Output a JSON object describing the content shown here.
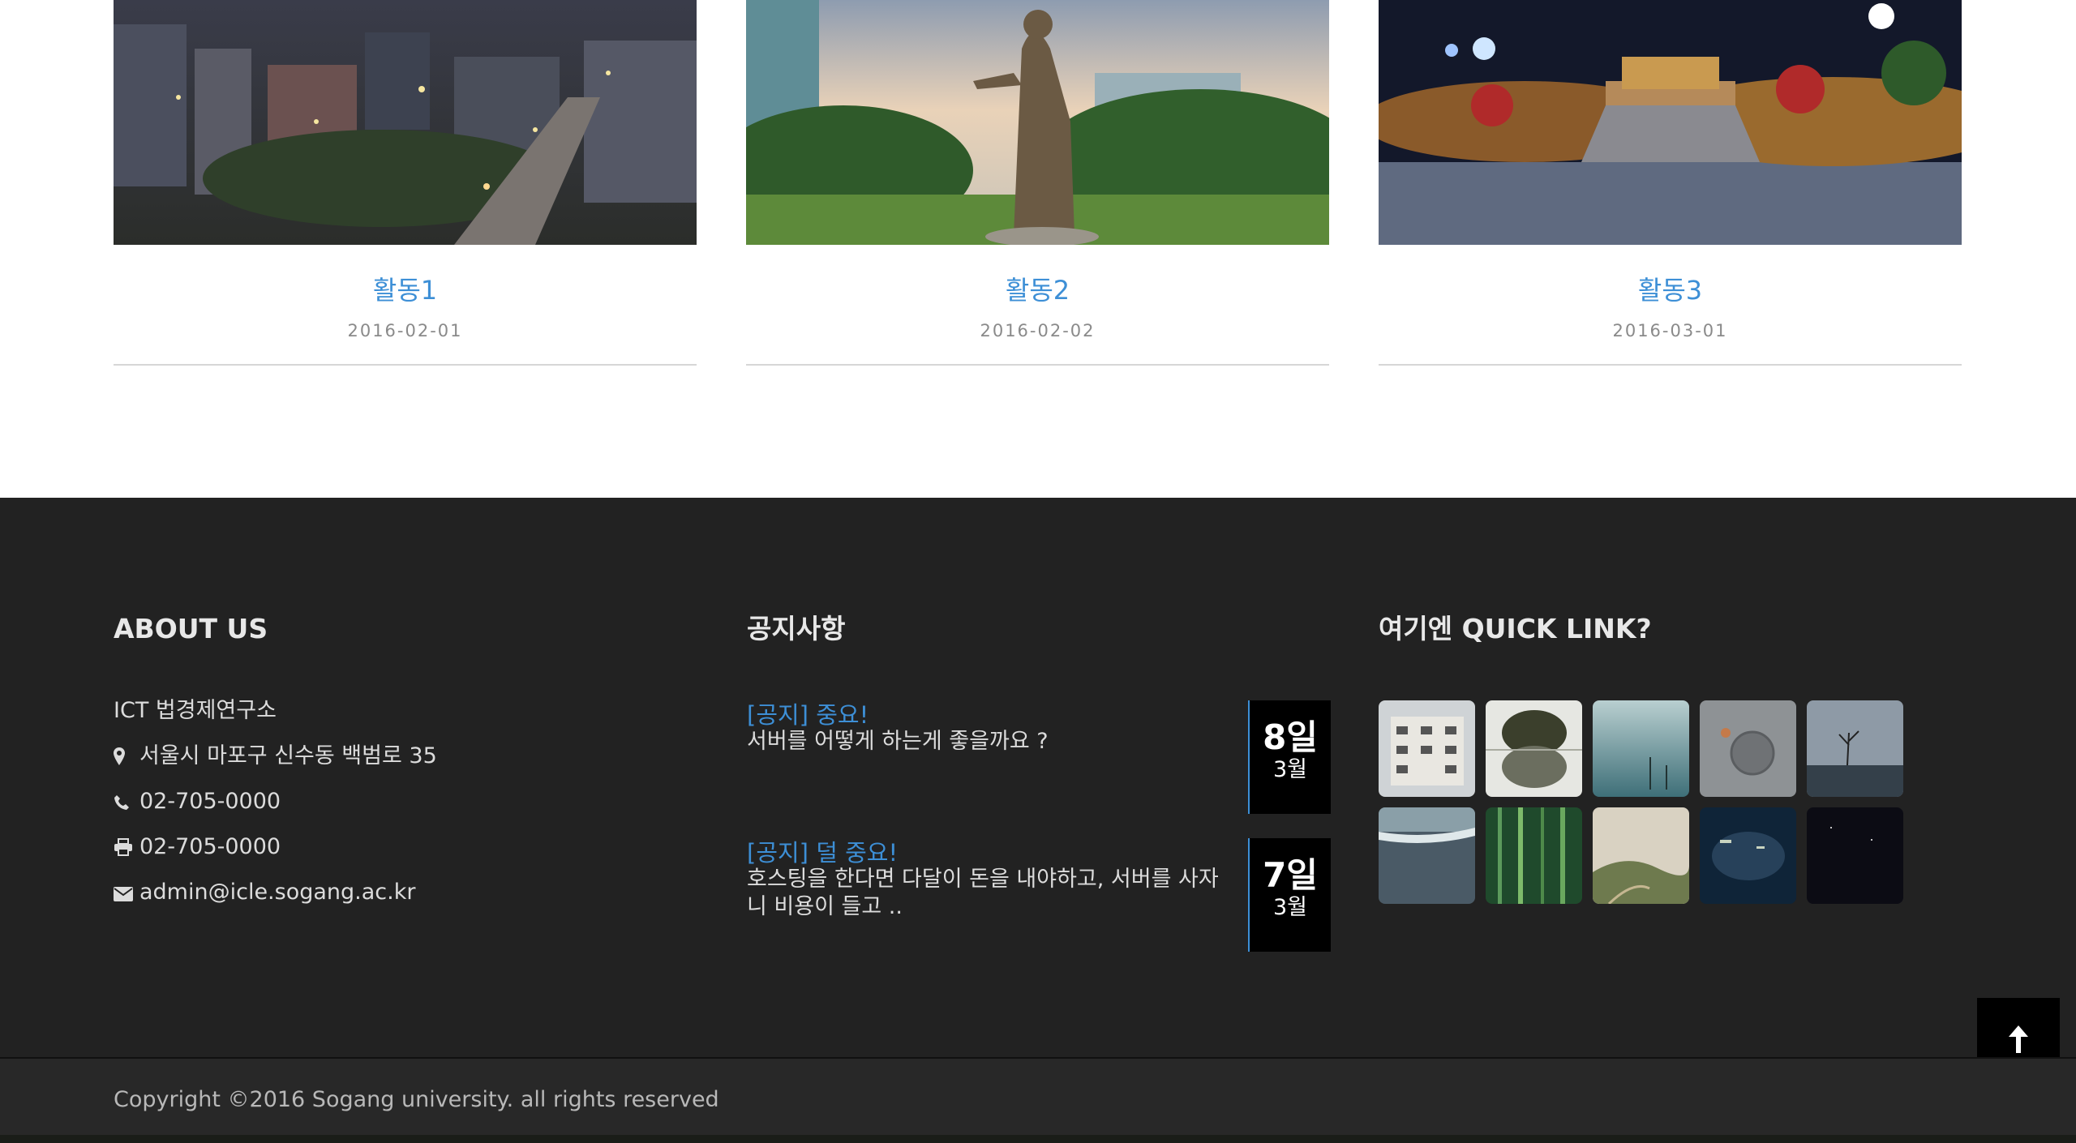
{
  "activities": [
    {
      "title": "활동1",
      "date": "2016-02-01",
      "image": "night-city-photo"
    },
    {
      "title": "활동2",
      "date": "2016-02-02",
      "image": "statue-campus-photo"
    },
    {
      "title": "활동3",
      "date": "2016-03-01",
      "image": "christmas-lights-photo"
    }
  ],
  "about": {
    "heading": "ABOUT US",
    "org": "ICT 법경제연구소",
    "address": "서울시 마포구 신수동 백범로 35",
    "phone": "02-705-0000",
    "fax": "02-705-0000",
    "email": "admin@icle.sogang.ac.kr",
    "icons": [
      "map-marker-icon",
      "phone-icon",
      "fax-icon",
      "envelope-icon"
    ]
  },
  "notices": {
    "heading": "공지사항",
    "items": [
      {
        "title": "[공지] 중요!",
        "body": "서버를 어떻게 하는게 좋을까요 ?",
        "day": "8일",
        "month": "3월"
      },
      {
        "title": "[공지] 덜 중요!",
        "body": "호스팅을 한다면 다달이 돈을 내야하고, 서버를 사자니 비용이 들고 ..",
        "day": "7일",
        "month": "3월"
      }
    ]
  },
  "quicklinks": {
    "heading": "여기엔 QUICK LINK?",
    "thumbs": [
      "building-photo",
      "tree-reflection-photo",
      "foggy-lake-photo",
      "manhole-photo",
      "bare-tree-sea-photo",
      "beach-photo",
      "bamboo-forest-photo",
      "hazy-hills-photo",
      "dark-water-photo",
      "night-sky-photo"
    ]
  },
  "footer": {
    "copyright": "Copyright ©2016 Sogang university. all rights reserved"
  },
  "scroll_top": {
    "icon": "arrow-up-icon"
  },
  "colors": {
    "accent": "#3d8fd6",
    "footer_bg": "#222222",
    "date_box": "#000000"
  }
}
